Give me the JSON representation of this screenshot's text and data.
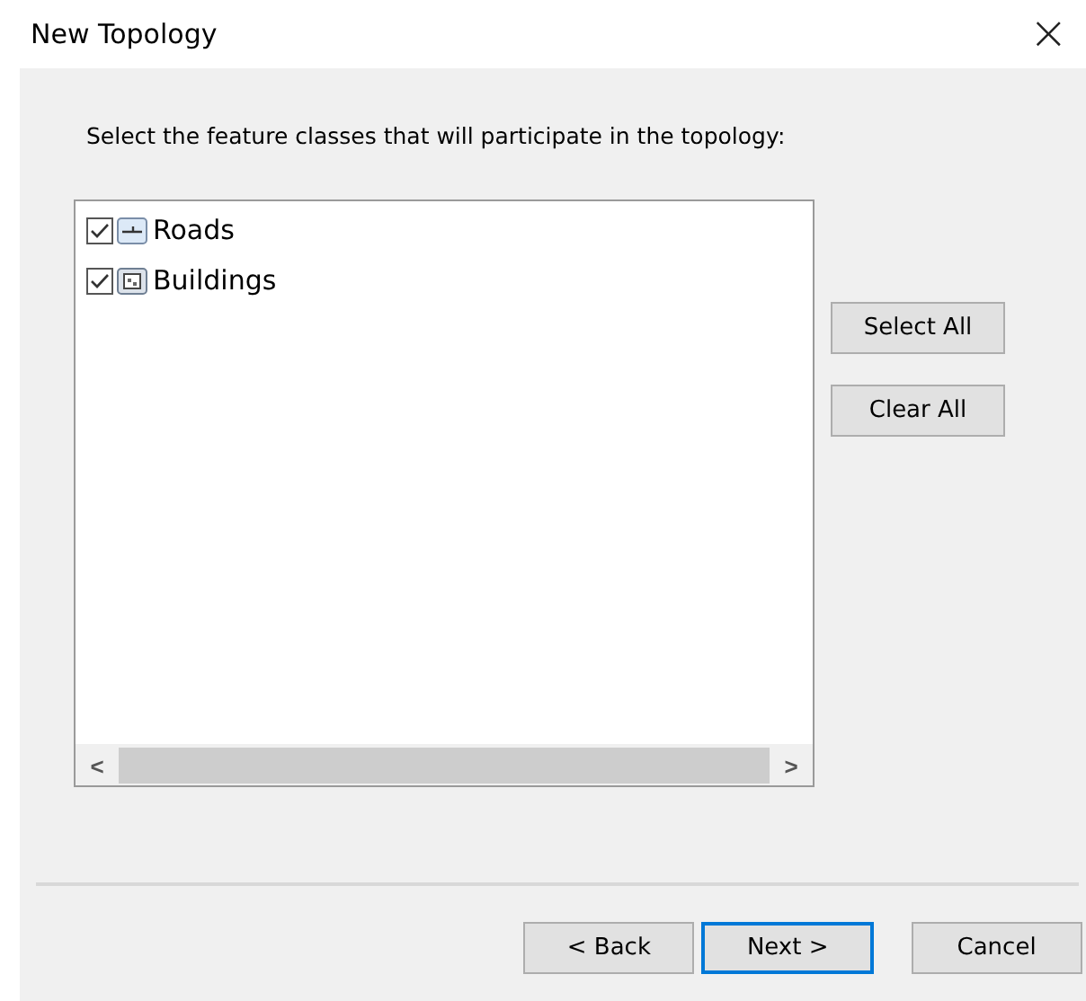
{
  "window": {
    "title": "New Topology",
    "close": "×"
  },
  "instruction": "Select the feature classes that will participate in the topology:",
  "feature_classes": [
    {
      "label": "Roads",
      "kind": "line",
      "checked": true
    },
    {
      "label": "Buildings",
      "kind": "polygon",
      "checked": true
    }
  ],
  "scrollbar": {
    "left": "<",
    "right": ">"
  },
  "side_buttons": [
    "Select All",
    "Clear All"
  ],
  "footer_buttons": [
    {
      "label": "< Back",
      "default": false
    },
    {
      "label": "Next >",
      "default": true
    },
    {
      "label": "Cancel",
      "default": false
    }
  ]
}
